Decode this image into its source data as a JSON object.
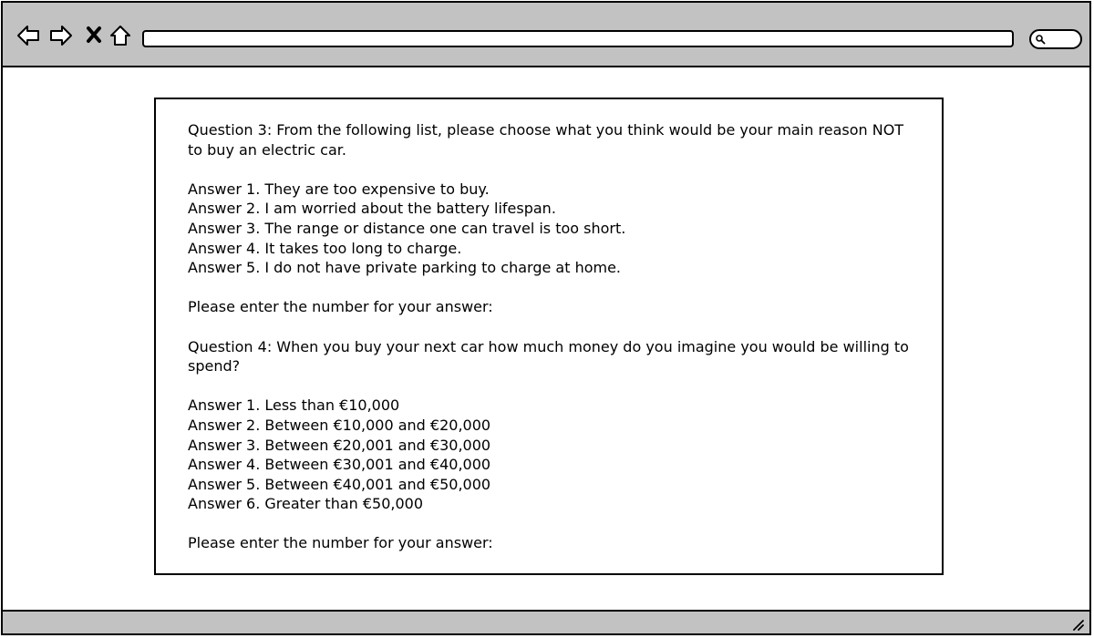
{
  "browser": {
    "address_value": "",
    "search_value": "",
    "icons": {
      "back": "back-arrow-icon",
      "forward": "forward-arrow-icon",
      "stop": "stop-x-icon",
      "home": "home-icon",
      "search": "magnifier-icon",
      "resize": "resize-grip-icon"
    },
    "colors": {
      "chrome": "#c2c2c2",
      "border": "#000000",
      "page": "#ffffff"
    }
  },
  "survey": {
    "q3": {
      "question_line1": "Question 3: From the following list, please choose what you think would be your main reason NOT",
      "question_line2": "to buy an electric car.",
      "answers": [
        "Answer 1. They are too expensive to buy.",
        "Answer 2. I am worried about the battery lifespan.",
        "Answer 3. The range or distance one can travel is too short.",
        "Answer 4. It takes too long to charge.",
        "Answer 5. I do not have private parking to charge at home."
      ],
      "prompt": "Please enter the number for your answer:"
    },
    "q4": {
      "question_line1": "Question 4: When you buy your next car how much money do you imagine you would be willing to",
      "question_line2": "spend?",
      "answers": [
        "Answer 1. Less than €10,000",
        "Answer 2. Between €10,000 and €20,000",
        "Answer 3. Between €20,001 and €30,000",
        "Answer 4. Between €30,001 and €40,000",
        "Answer 5. Between €40,001 and €50,000",
        "Answer 6. Greater than €50,000"
      ],
      "prompt": "Please enter the number for your answer:"
    }
  }
}
